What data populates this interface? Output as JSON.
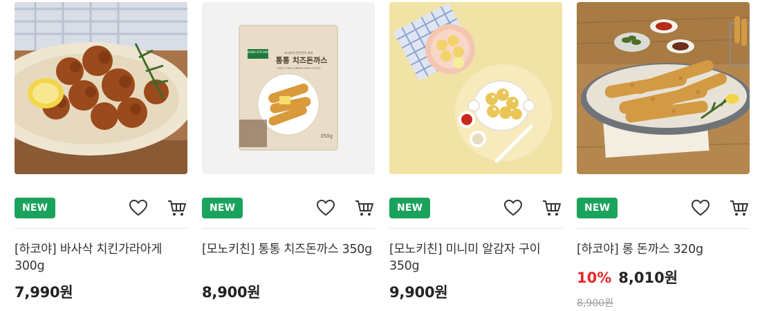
{
  "products": [
    {
      "badge": "NEW",
      "name": "[하코야] 바사삭 치킨가라아게 300g",
      "price": "7,990원",
      "image_icon": "fried-chicken-karaage-photo"
    },
    {
      "badge": "NEW",
      "name": "[모노키친] 통통 치즈돈까스 350g",
      "price": "8,900원",
      "image_icon": "cheese-tonkatsu-package-photo",
      "package": {
        "brand": "MONO KITCHEN",
        "tagline": "바삭바삭 쫀득쫀득 파파",
        "title": "통통 치즈돈까스",
        "subtitle": "TONG TONG CHEESE PORK CUTLET",
        "weight": "350g"
      }
    },
    {
      "badge": "NEW",
      "name": "[모노키친] 미니미 알감자 구이 350g",
      "price": "9,900원",
      "image_icon": "roasted-baby-potatoes-photo"
    },
    {
      "badge": "NEW",
      "name": "[하코야] 롱 돈까스 320g",
      "discount_rate": "10%",
      "price": "8,010원",
      "original_price": "8,900원",
      "image_icon": "long-pork-cutlet-photo"
    }
  ],
  "icons": {
    "wish": "heart-icon",
    "cart": "cart-icon"
  },
  "colors": {
    "badge": "#1aa35c",
    "discount": "#e8272a",
    "price": "#222222",
    "original_price": "#9b9b9b"
  }
}
